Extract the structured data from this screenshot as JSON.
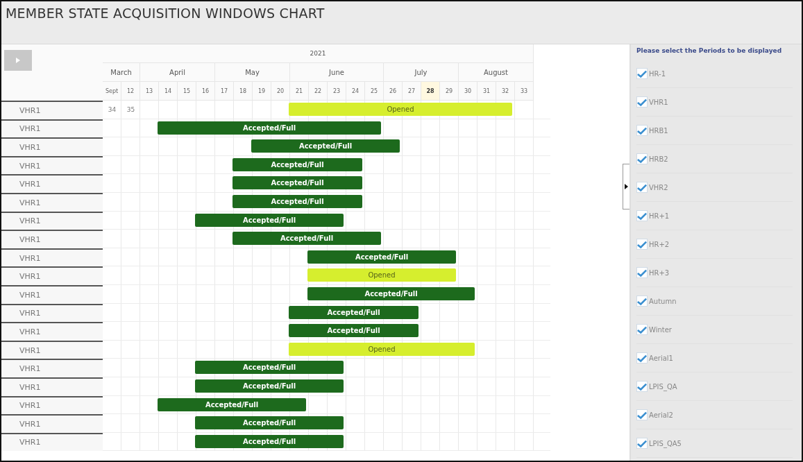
{
  "title": "MEMBER STATE ACQUISITION WINDOWS CHART",
  "year": "2021",
  "months": [
    {
      "label": "March"
    },
    {
      "label": "April"
    },
    {
      "label": "May"
    },
    {
      "label": "June"
    },
    {
      "label": "July"
    },
    {
      "label": "August"
    }
  ],
  "weeks": [
    {
      "label": "Sept",
      "highlighted": false
    },
    {
      "label": "12",
      "highlighted": false
    },
    {
      "label": "13",
      "highlighted": false
    },
    {
      "label": "14",
      "highlighted": false
    },
    {
      "label": "15",
      "highlighted": false
    },
    {
      "label": "16",
      "highlighted": false
    },
    {
      "label": "17",
      "highlighted": false
    },
    {
      "label": "18",
      "highlighted": false
    },
    {
      "label": "19",
      "highlighted": false
    },
    {
      "label": "20",
      "highlighted": false
    },
    {
      "label": "21",
      "highlighted": false
    },
    {
      "label": "22",
      "highlighted": false
    },
    {
      "label": "23",
      "highlighted": false
    },
    {
      "label": "24",
      "highlighted": false
    },
    {
      "label": "25",
      "highlighted": false
    },
    {
      "label": "26",
      "highlighted": false
    },
    {
      "label": "27",
      "highlighted": false
    },
    {
      "label": "28",
      "highlighted": true
    },
    {
      "label": "29",
      "highlighted": false
    },
    {
      "label": "30",
      "highlighted": false
    },
    {
      "label": "31",
      "highlighted": false
    },
    {
      "label": "32",
      "highlighted": false
    },
    {
      "label": "33",
      "highlighted": false
    }
  ],
  "rows": [
    {
      "label": "VHR1",
      "cells": [
        "34",
        "35"
      ],
      "bar": {
        "kind": "opened",
        "text": "Opened"
      }
    },
    {
      "label": "VHR1",
      "bar": {
        "kind": "accepted",
        "text": "Accepted/Full"
      }
    },
    {
      "label": "VHR1",
      "bar": {
        "kind": "accepted",
        "text": "Accepted/Full"
      }
    },
    {
      "label": "VHR1",
      "bar": {
        "kind": "accepted",
        "text": "Accepted/Full"
      }
    },
    {
      "label": "VHR1",
      "bar": {
        "kind": "accepted",
        "text": "Accepted/Full"
      }
    },
    {
      "label": "VHR1",
      "bar": {
        "kind": "accepted",
        "text": "Accepted/Full"
      }
    },
    {
      "label": "VHR1",
      "bar": {
        "kind": "accepted",
        "text": "Accepted/Full"
      }
    },
    {
      "label": "VHR1",
      "bar": {
        "kind": "accepted",
        "text": "Accepted/Full"
      }
    },
    {
      "label": "VHR1",
      "bar": {
        "kind": "accepted",
        "text": "Accepted/Full"
      }
    },
    {
      "label": "VHR1",
      "bar": {
        "kind": "opened",
        "text": "Opened"
      }
    },
    {
      "label": "VHR1",
      "bar": {
        "kind": "accepted",
        "text": "Accepted/Full"
      }
    },
    {
      "label": "VHR1",
      "bar": {
        "kind": "accepted",
        "text": "Accepted/Full"
      }
    },
    {
      "label": "VHR1",
      "bar": {
        "kind": "accepted",
        "text": "Accepted/Full"
      }
    },
    {
      "label": "VHR1",
      "bar": {
        "kind": "opened",
        "text": "Opened"
      }
    },
    {
      "label": "VHR1",
      "bar": {
        "kind": "accepted",
        "text": "Accepted/Full"
      }
    },
    {
      "label": "VHR1",
      "bar": {
        "kind": "accepted",
        "text": "Accepted/Full"
      }
    },
    {
      "label": "VHR1",
      "bar": {
        "kind": "accepted",
        "text": "Accepted/Full"
      }
    },
    {
      "label": "VHR1",
      "bar": {
        "kind": "accepted",
        "text": "Accepted/Full"
      }
    },
    {
      "label": "VHR1",
      "bar": {
        "kind": "accepted",
        "text": "Accepted/Full"
      }
    }
  ],
  "panel": {
    "heading": "Please select the Periods to be displayed",
    "periods": [
      {
        "label": "HR-1",
        "checked": true
      },
      {
        "label": "VHR1",
        "checked": true
      },
      {
        "label": "HRB1",
        "checked": true
      },
      {
        "label": "HRB2",
        "checked": true
      },
      {
        "label": "VHR2",
        "checked": true
      },
      {
        "label": "HR+1",
        "checked": true
      },
      {
        "label": "HR+2",
        "checked": true
      },
      {
        "label": "HR+3",
        "checked": true
      },
      {
        "label": "Autumn",
        "checked": true
      },
      {
        "label": "Winter",
        "checked": true
      },
      {
        "label": "Aerial1",
        "checked": true
      },
      {
        "label": "LPIS_QA",
        "checked": true
      },
      {
        "label": "Aerial2",
        "checked": true
      },
      {
        "label": "LPIS_QA5",
        "checked": true
      }
    ]
  }
}
